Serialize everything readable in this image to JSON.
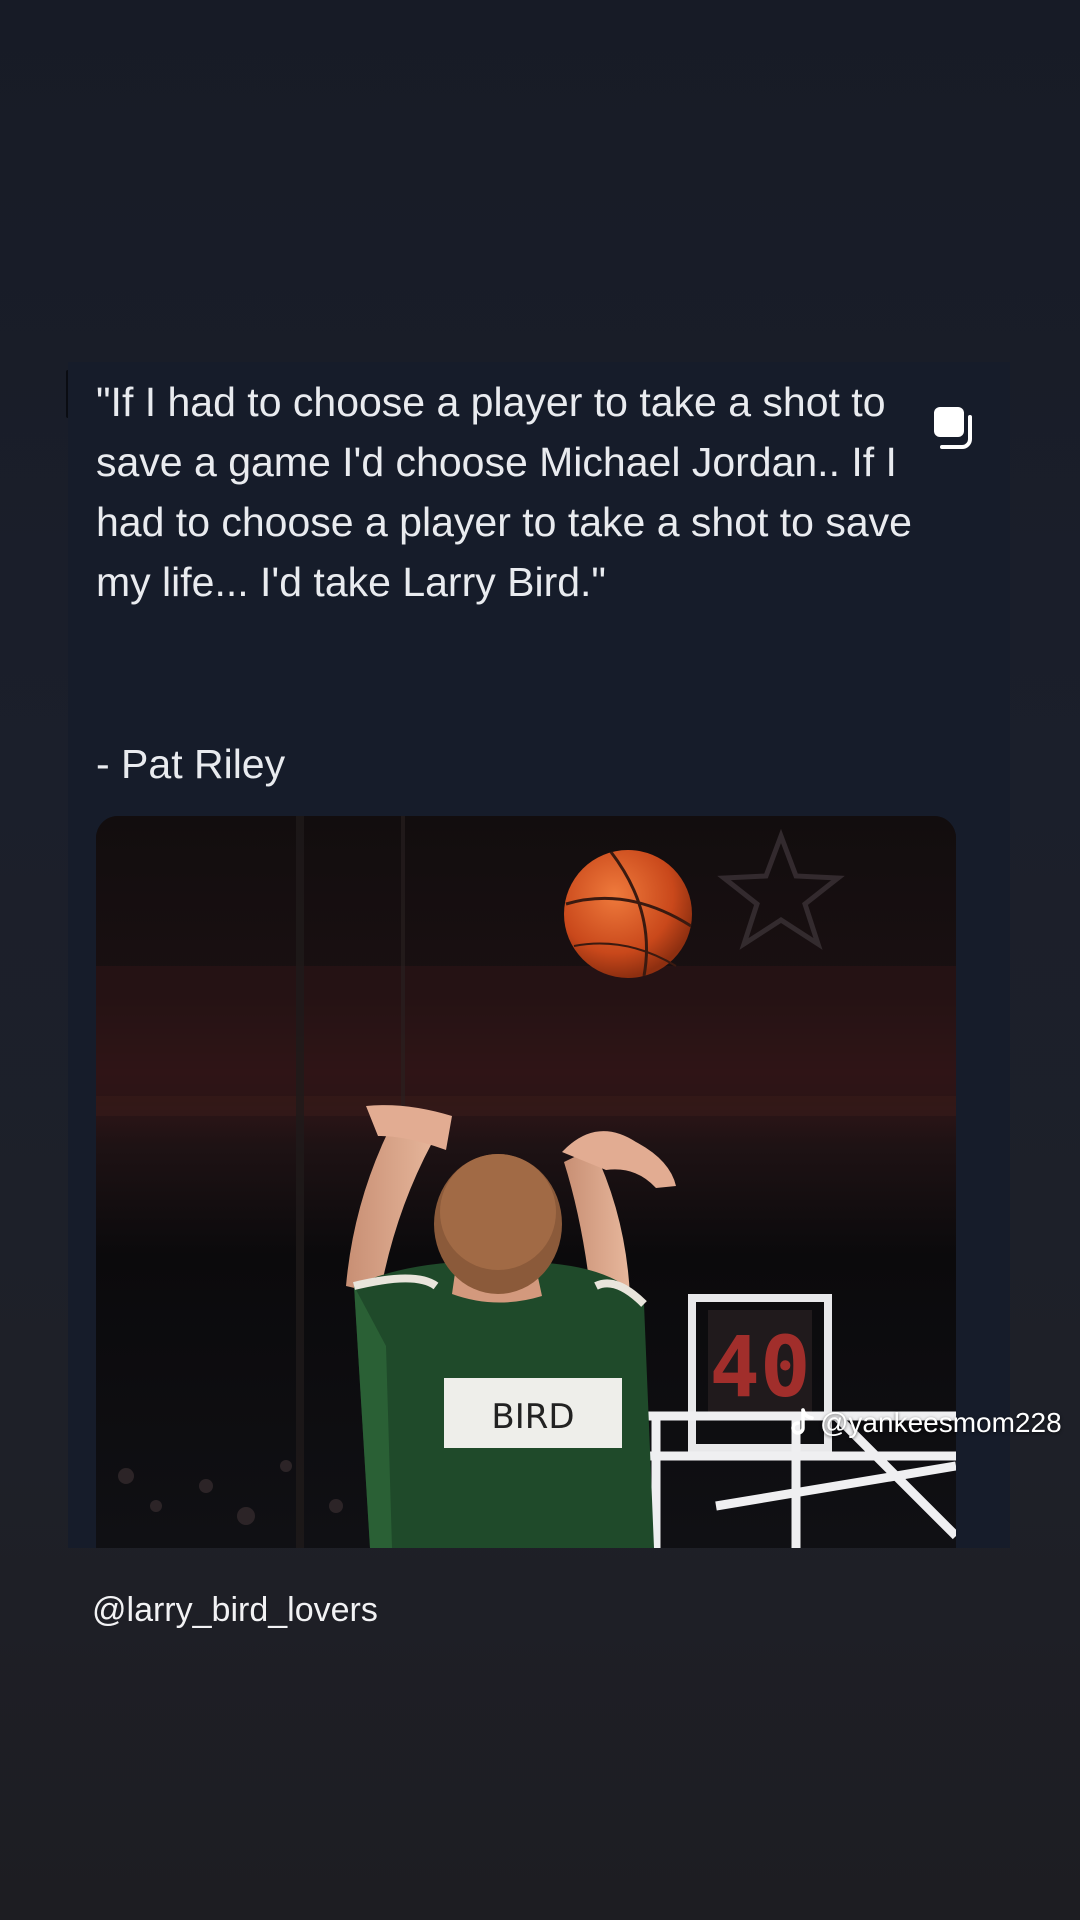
{
  "post": {
    "quote": "\"If I had to choose a player to take a shot to save a game I'd choose Michael Jordan.. If I had to choose a player to take a shot to save my life... I'd take Larry Bird.\"",
    "attribution": "- Pat Riley"
  },
  "photo": {
    "jersey_name": "BIRD",
    "shot_clock": "40"
  },
  "watermark": {
    "icon": "tiktok-icon",
    "text": "@yankeesmom228"
  },
  "footer": {
    "handle": "@larry_bird_lovers"
  },
  "icons": {
    "copy": "copy-icon"
  },
  "colors": {
    "background": "#1b1f2b",
    "card": "#161c2a",
    "text": "#e9ebef",
    "jersey_green": "#1f4a2a",
    "ball": "#d2521f"
  }
}
